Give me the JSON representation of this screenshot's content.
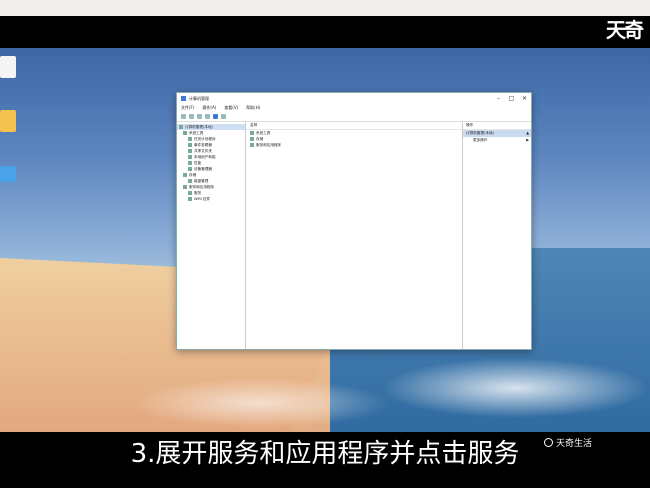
{
  "video": {
    "caption": "3.展开服务和应用程序并点击服务",
    "watermark": "天奇生活",
    "corner_logo": "天奇"
  },
  "window": {
    "title": "计算机管理",
    "controls": {
      "minimize": "–",
      "maximize": "□",
      "close": "✕"
    },
    "menu": [
      "文件(F)",
      "操作(A)",
      "查看(V)",
      "帮助(H)"
    ],
    "tree": [
      {
        "label": "计算机管理(本地)",
        "selected": true
      },
      {
        "label": "系统工具"
      },
      {
        "label": "任务计划程序"
      },
      {
        "label": "事件查看器"
      },
      {
        "label": "共享文件夹"
      },
      {
        "label": "本地用户和组"
      },
      {
        "label": "性能"
      },
      {
        "label": "设备管理器"
      },
      {
        "label": "存储"
      },
      {
        "label": "磁盘管理"
      },
      {
        "label": "服务和应用程序"
      },
      {
        "label": "服务"
      },
      {
        "label": "WMI 控件"
      }
    ],
    "center": {
      "header": "名称",
      "rows": [
        "系统工具",
        "存储",
        "服务和应用程序"
      ]
    },
    "actions": {
      "header": "操作",
      "section": "计算机管理(本地)",
      "more": "更多操作"
    }
  }
}
